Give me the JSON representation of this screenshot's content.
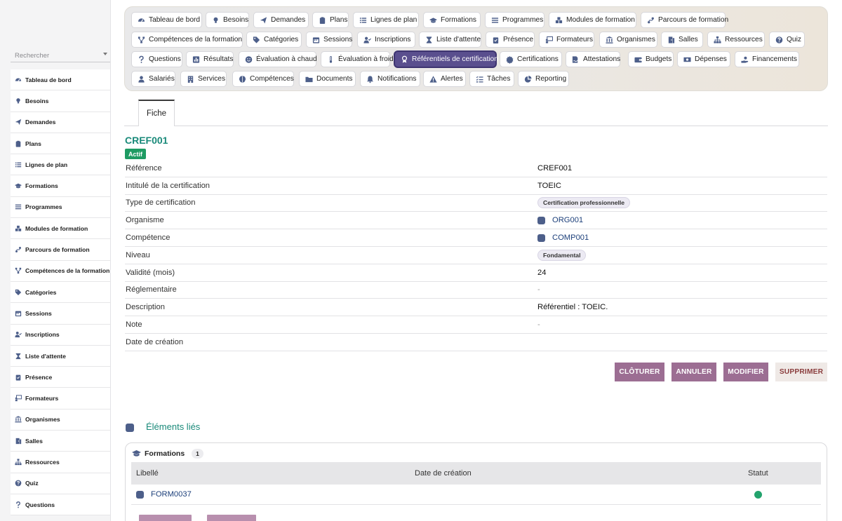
{
  "sidebar": {
    "search_placeholder": "Rechercher",
    "items": [
      {
        "label": "Tableau de bord",
        "icon": "dashboard-icon"
      },
      {
        "label": "Besoins",
        "icon": "lightbulb-icon"
      },
      {
        "label": "Demandes",
        "icon": "paper-plane-icon"
      },
      {
        "label": "Plans",
        "icon": "clipboard-icon"
      },
      {
        "label": "Lignes de plan",
        "icon": "list-icon"
      },
      {
        "label": "Formations",
        "icon": "graduation-cap-icon"
      },
      {
        "label": "Programmes",
        "icon": "bars-icon"
      },
      {
        "label": "Modules de formation",
        "icon": "cubes-icon"
      },
      {
        "label": "Parcours de formation",
        "icon": "route-icon"
      },
      {
        "label": "Compétences de la formation",
        "icon": "network-icon"
      },
      {
        "label": "Catégories",
        "icon": "tags-icon"
      },
      {
        "label": "Sessions",
        "icon": "calendar-icon"
      },
      {
        "label": "Inscriptions",
        "icon": "user-check-icon"
      },
      {
        "label": "Liste d'attente",
        "icon": "hourglass-icon"
      },
      {
        "label": "Présence",
        "icon": "clipboard-check-icon"
      },
      {
        "label": "Formateurs",
        "icon": "chalkboard-teacher-icon"
      },
      {
        "label": "Organismes",
        "icon": "building-columns-icon"
      },
      {
        "label": "Salles",
        "icon": "door-icon"
      },
      {
        "label": "Ressources",
        "icon": "sitemap-icon"
      },
      {
        "label": "Quiz",
        "icon": "question-circle-icon"
      },
      {
        "label": "Questions",
        "icon": "question-icon"
      }
    ]
  },
  "topnav": {
    "items": [
      {
        "label": "Tableau de bord",
        "icon": "dashboard-icon"
      },
      {
        "label": "Besoins",
        "icon": "lightbulb-icon"
      },
      {
        "label": "Demandes",
        "icon": "paper-plane-icon"
      },
      {
        "label": "Plans",
        "icon": "clipboard-icon"
      },
      {
        "label": "Lignes de plan",
        "icon": "list-icon"
      },
      {
        "label": "Formations",
        "icon": "graduation-cap-icon"
      },
      {
        "label": "Programmes",
        "icon": "bars-icon"
      },
      {
        "label": "Modules de formation",
        "icon": "cubes-icon"
      },
      {
        "label": "Parcours de formation",
        "icon": "route-icon"
      },
      {
        "label": "Compétences de la formation",
        "icon": "network-icon"
      },
      {
        "label": "Catégories",
        "icon": "tags-icon"
      },
      {
        "label": "Sessions",
        "icon": "calendar-icon"
      },
      {
        "label": "Inscriptions",
        "icon": "user-check-icon"
      },
      {
        "label": "Liste d'attente",
        "icon": "hourglass-icon"
      },
      {
        "label": "Présence",
        "icon": "clipboard-check-icon"
      },
      {
        "label": "Formateurs",
        "icon": "chalkboard-teacher-icon"
      },
      {
        "label": "Organismes",
        "icon": "building-columns-icon"
      },
      {
        "label": "Salles",
        "icon": "door-icon"
      },
      {
        "label": "Ressources",
        "icon": "sitemap-icon"
      },
      {
        "label": "Quiz",
        "icon": "question-circle-icon"
      },
      {
        "label": "Questions",
        "icon": "question-icon"
      },
      {
        "label": "Résultats",
        "icon": "poll-icon"
      },
      {
        "label": "Évaluation à chaud",
        "icon": "smile-icon"
      },
      {
        "label": "Évaluation à froid",
        "icon": "thermometer-icon"
      },
      {
        "label": "Référentiels de certification",
        "icon": "award-icon"
      },
      {
        "label": "Certifications",
        "icon": "certificate-icon"
      },
      {
        "label": "Attestations",
        "icon": "file-signature-icon"
      },
      {
        "label": "Budgets",
        "icon": "wallet-icon"
      },
      {
        "label": "Dépenses",
        "icon": "money-bill-icon"
      },
      {
        "label": "Financements",
        "icon": "hand-holding-icon"
      },
      {
        "label": "Salariés",
        "icon": "user-icon"
      },
      {
        "label": "Services",
        "icon": "building-icon"
      },
      {
        "label": "Compétences",
        "icon": "brain-icon"
      },
      {
        "label": "Documents",
        "icon": "folder-icon"
      },
      {
        "label": "Notifications",
        "icon": "bell-icon"
      },
      {
        "label": "Alertes",
        "icon": "warning-icon"
      },
      {
        "label": "Tâches",
        "icon": "tasks-icon"
      },
      {
        "label": "Reporting",
        "icon": "chart-pie-icon"
      }
    ],
    "active_index": 24
  },
  "tabs": {
    "fiche": "Fiche"
  },
  "record": {
    "title": "CREF001",
    "status": "Actif",
    "status_color": "#1e9b63",
    "fields": [
      {
        "label": "Référence",
        "value": "CREF001",
        "kind": "text"
      },
      {
        "label": "Intitulé de la certification",
        "value": "TOEIC",
        "kind": "text"
      },
      {
        "label": "Type de certification",
        "value": "Certification professionnelle",
        "kind": "pill"
      },
      {
        "label": "Organisme",
        "value": "ORG001",
        "kind": "link"
      },
      {
        "label": "Compétence",
        "value": "COMP001",
        "kind": "link"
      },
      {
        "label": "Niveau",
        "value": "Fondamental",
        "kind": "pill"
      },
      {
        "label": "Validité (mois)",
        "value": "24",
        "kind": "text"
      },
      {
        "label": "Réglementaire",
        "value": "-",
        "kind": "dim"
      },
      {
        "label": "Description",
        "value": "Référentiel : TOEIC.",
        "kind": "text"
      },
      {
        "label": "Note",
        "value": "-",
        "kind": "dim"
      },
      {
        "label": "Date de création",
        "value": "",
        "kind": "text"
      }
    ]
  },
  "actions": {
    "close": "CLÔTURER",
    "cancel": "ANNULER",
    "edit": "MODIFIER",
    "delete": "SUPPRIMER"
  },
  "linked": {
    "title": "Éléments liés",
    "section": {
      "title": "Formations",
      "count": "1",
      "columns": [
        "Libellé",
        "Date de création",
        "Statut"
      ],
      "rows": [
        {
          "label": "FORM0037",
          "date": "",
          "status_color": "#23a36d"
        }
      ]
    }
  }
}
